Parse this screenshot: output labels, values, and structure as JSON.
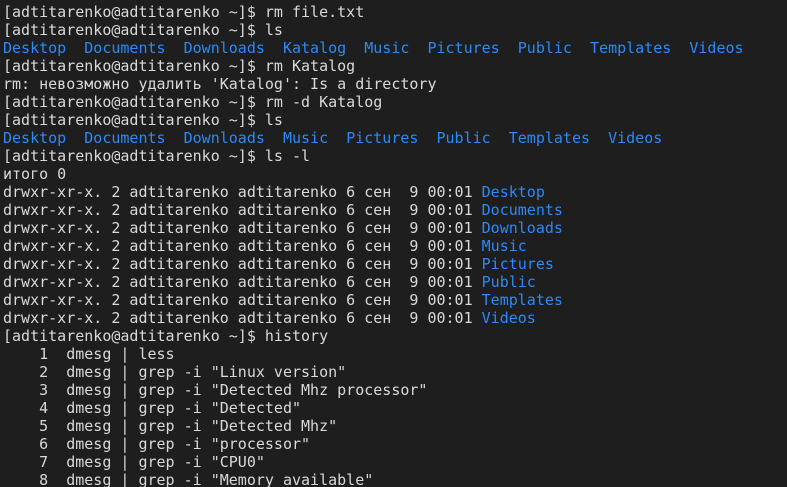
{
  "colors": {
    "background": "#1e1e1e",
    "foreground": "#d9d9d9",
    "directory": "#2b8af7"
  },
  "terminal": {
    "lines": [
      {
        "type": "text",
        "text": "[adtitarenko@adtitarenko ~]$ rm file.txt"
      },
      {
        "type": "text",
        "text": "[adtitarenko@adtitarenko ~]$ ls"
      },
      {
        "type": "dirs",
        "items": [
          "Desktop",
          "Documents",
          "Downloads",
          "Katalog",
          "Music",
          "Pictures",
          "Public",
          "Templates",
          "Videos"
        ]
      },
      {
        "type": "text",
        "text": "[adtitarenko@adtitarenko ~]$ rm Katalog"
      },
      {
        "type": "text",
        "text": "rm: невозможно удалить 'Katalog': Is a directory"
      },
      {
        "type": "text",
        "text": "[adtitarenko@adtitarenko ~]$ rm -d Katalog"
      },
      {
        "type": "text",
        "text": "[adtitarenko@adtitarenko ~]$ ls"
      },
      {
        "type": "dirs",
        "items": [
          "Desktop",
          "Documents",
          "Downloads",
          "Music",
          "Pictures",
          "Public",
          "Templates",
          "Videos"
        ]
      },
      {
        "type": "text",
        "text": "[adtitarenko@adtitarenko ~]$ ls -l"
      },
      {
        "type": "text",
        "text": "итого 0"
      },
      {
        "type": "entry",
        "prefix": "drwxr-xr-x. 2 adtitarenko adtitarenko 6 сен  9 00:01 ",
        "name": "Desktop"
      },
      {
        "type": "entry",
        "prefix": "drwxr-xr-x. 2 adtitarenko adtitarenko 6 сен  9 00:01 ",
        "name": "Documents"
      },
      {
        "type": "entry",
        "prefix": "drwxr-xr-x. 2 adtitarenko adtitarenko 6 сен  9 00:01 ",
        "name": "Downloads"
      },
      {
        "type": "entry",
        "prefix": "drwxr-xr-x. 2 adtitarenko adtitarenko 6 сен  9 00:01 ",
        "name": "Music"
      },
      {
        "type": "entry",
        "prefix": "drwxr-xr-x. 2 adtitarenko adtitarenko 6 сен  9 00:01 ",
        "name": "Pictures"
      },
      {
        "type": "entry",
        "prefix": "drwxr-xr-x. 2 adtitarenko adtitarenko 6 сен  9 00:01 ",
        "name": "Public"
      },
      {
        "type": "entry",
        "prefix": "drwxr-xr-x. 2 adtitarenko adtitarenko 6 сен  9 00:01 ",
        "name": "Templates"
      },
      {
        "type": "entry",
        "prefix": "drwxr-xr-x. 2 adtitarenko adtitarenko 6 сен  9 00:01 ",
        "name": "Videos"
      },
      {
        "type": "text",
        "text": "[adtitarenko@adtitarenko ~]$ history"
      },
      {
        "type": "text",
        "text": "    1  dmesg | less"
      },
      {
        "type": "text",
        "text": "    2  dmesg | grep -i \"Linux version\""
      },
      {
        "type": "text",
        "text": "    3  dmesg | grep -i \"Detected Mhz processor\""
      },
      {
        "type": "text",
        "text": "    4  dmesg | grep -i \"Detected\""
      },
      {
        "type": "text",
        "text": "    5  dmesg | grep -i \"Detected Mhz\""
      },
      {
        "type": "text",
        "text": "    6  dmesg | grep -i \"processor\""
      },
      {
        "type": "text",
        "text": "    7  dmesg | grep -i \"CPU0\""
      },
      {
        "type": "text",
        "text": "    8  dmesg | grep -i \"Memory available\""
      }
    ]
  }
}
